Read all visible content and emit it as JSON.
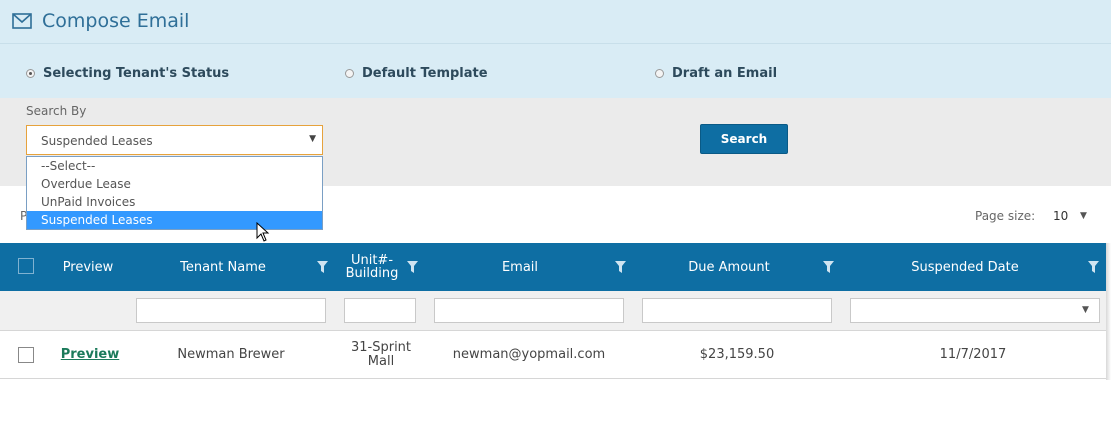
{
  "header": {
    "title": "Compose Email",
    "icon": "envelope-icon"
  },
  "radios": [
    {
      "label": "Selecting Tenant's Status",
      "checked": true
    },
    {
      "label": "Default Template",
      "checked": false
    },
    {
      "label": "Draft an Email",
      "checked": false
    }
  ],
  "search": {
    "label": "Search By",
    "selected": "Suspended Leases",
    "button_label": "Search",
    "options": [
      "--Select--",
      "Overdue Lease",
      "UnPaid Invoices",
      "Suspended Leases"
    ]
  },
  "pager": {
    "stub": "P",
    "page_size_label": "Page size:",
    "page_size_value": "10"
  },
  "grid": {
    "columns": [
      "Preview",
      "Tenant Name",
      "Unit#-\nBuilding",
      "Email",
      "Due Amount",
      "Suspended Date"
    ],
    "rows": [
      {
        "preview": "Preview",
        "tenant_name": "Newman Brewer",
        "unit_building": "31-Sprint\nMall",
        "email": "newman@yopmail.com",
        "due_amount": "$23,159.50",
        "suspended_date": "11/7/2017"
      }
    ]
  },
  "colors": {
    "header_bg": "#d9ecf5",
    "grid_header_bg": "#0e6ea3",
    "button_bg": "#0e6ea3",
    "select_border": "#e6a23c",
    "dropdown_selected": "#3399ff",
    "link": "#1b7a5a"
  }
}
